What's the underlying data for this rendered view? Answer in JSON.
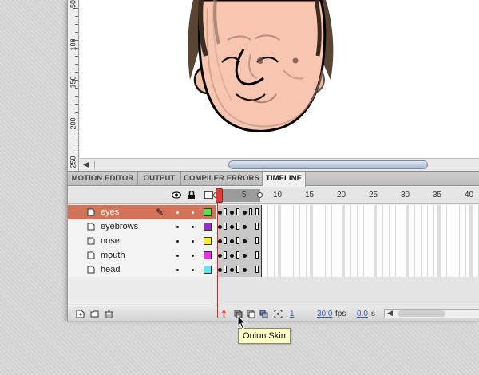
{
  "ruler": {
    "labels": [
      "50",
      "100",
      "150",
      "200",
      "250"
    ]
  },
  "panel_tabs": [
    {
      "label": "MOTION EDITOR",
      "active": false
    },
    {
      "label": "OUTPUT",
      "active": false
    },
    {
      "label": "COMPILER ERRORS",
      "active": false
    },
    {
      "label": "TIMELINE",
      "active": true
    }
  ],
  "frame_numbers": [
    "5",
    "10",
    "15",
    "20",
    "25",
    "30",
    "35",
    "40"
  ],
  "layers": [
    {
      "name": "eyes",
      "color": "#4ee64a",
      "selected": true
    },
    {
      "name": "eyebrows",
      "color": "#9b30c8",
      "selected": false
    },
    {
      "name": "nose",
      "color": "#f6f02a",
      "selected": false
    },
    {
      "name": "mouth",
      "color": "#ee2ee6",
      "selected": false
    },
    {
      "name": "head",
      "color": "#5ee8f0",
      "selected": false
    }
  ],
  "bottom_bar": {
    "current_frame": "1",
    "fps_value": "30.0",
    "fps_unit": "fps",
    "time_value": "0.0",
    "time_unit": "s"
  },
  "tooltip": {
    "text": "Onion Skin"
  },
  "colors": {
    "playhead": "#d9403a",
    "selected_layer": "#d2735a"
  }
}
